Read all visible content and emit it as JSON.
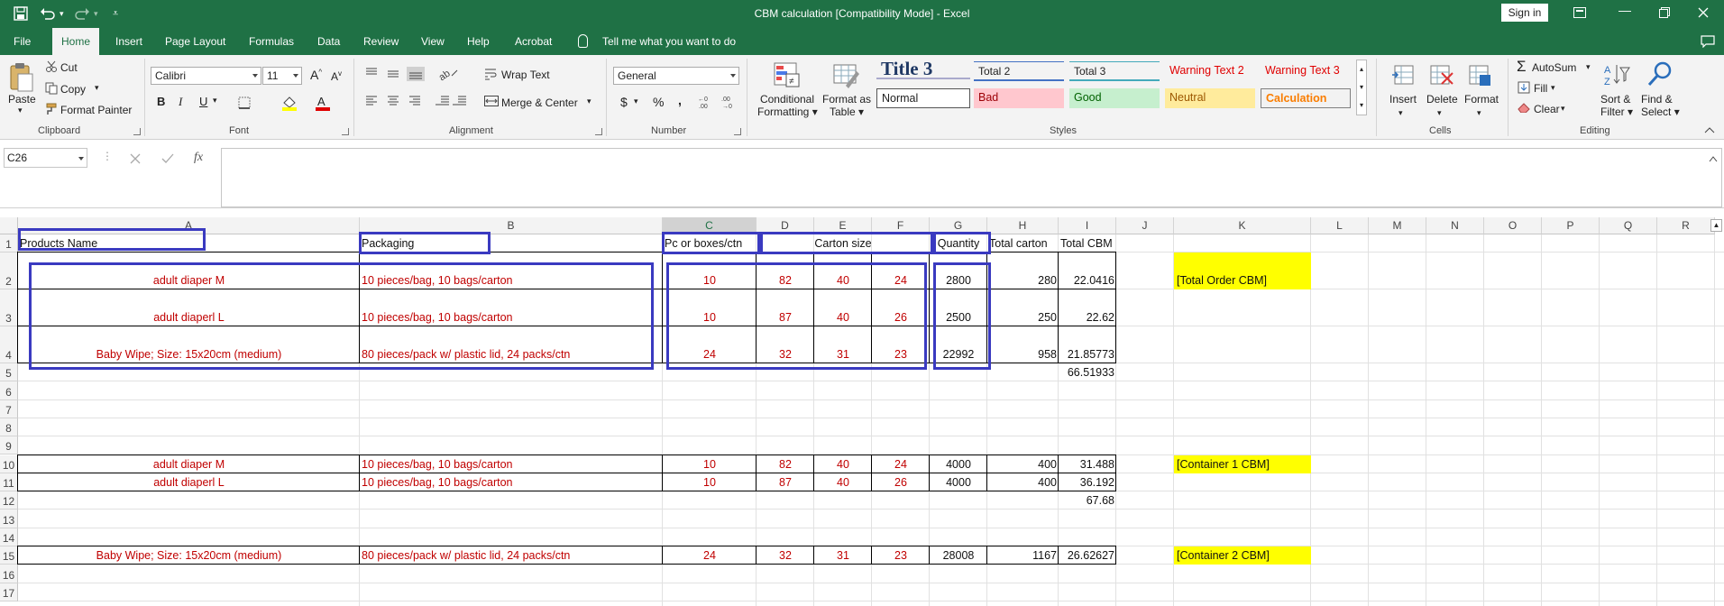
{
  "window": {
    "title": "CBM calculation  [Compatibility Mode]  -  Excel",
    "sign_in": "Sign in"
  },
  "tabs": [
    "File",
    "Home",
    "Insert",
    "Page Layout",
    "Formulas",
    "Data",
    "Review",
    "View",
    "Help",
    "Acrobat"
  ],
  "active_tab": "Home",
  "tell_me": "Tell me what you want to do",
  "ribbon": {
    "clipboard": {
      "label": "Clipboard",
      "paste": "Paste",
      "cut": "Cut",
      "copy": "Copy",
      "format_painter": "Format Painter"
    },
    "font": {
      "label": "Font",
      "name": "Calibri",
      "size": "11",
      "bold": "B",
      "italic": "I",
      "underline": "U"
    },
    "alignment": {
      "label": "Alignment",
      "wrap": "Wrap Text",
      "merge": "Merge & Center"
    },
    "number": {
      "label": "Number",
      "format": "General",
      "currency": "$",
      "percent": "%",
      "comma": ","
    },
    "styles": {
      "label": "Styles",
      "conditional": [
        "Conditional",
        "Formatting"
      ],
      "format_table": [
        "Format as",
        "Table"
      ],
      "title3": "Title 3",
      "total2": "Total 2",
      "total3": "Total 3",
      "warning2": "Warning Text 2",
      "warning3": "Warning Text 3",
      "normal": "Normal",
      "bad": "Bad",
      "good": "Good",
      "neutral": "Neutral",
      "calculation": "Calculation"
    },
    "cells": {
      "label": "Cells",
      "insert": "Insert",
      "delete": "Delete",
      "format": "Format"
    },
    "editing": {
      "label": "Editing",
      "autosum": "AutoSum",
      "fill": "Fill",
      "clear": "Clear",
      "sort": [
        "Sort &",
        "Filter"
      ],
      "find": [
        "Find &",
        "Select"
      ]
    }
  },
  "name_box": "C26",
  "columns": [
    "A",
    "B",
    "C",
    "D",
    "E",
    "F",
    "G",
    "H",
    "I",
    "J",
    "K",
    "L",
    "M",
    "N",
    "O",
    "P",
    "Q",
    "R"
  ],
  "selected_column": "C",
  "rows": [
    "1",
    "2",
    "3",
    "4",
    "5",
    "6",
    "7",
    "8",
    "9",
    "10",
    "11",
    "12",
    "13",
    "14",
    "15",
    "16",
    "17"
  ],
  "headers": {
    "product": "Products Name",
    "packaging": "Packaging",
    "pc": "Pc or boxes/ctn",
    "carton": "Carton size",
    "quantity": "Quantity",
    "total_carton": "Total carton",
    "total_cbm": "Total CBM"
  },
  "table1": [
    {
      "product": "adult diaper M",
      "packaging": "10 pieces/bag, 10 bags/carton",
      "pc": "10",
      "d": "82",
      "e": "40",
      "f": "24",
      "qty": "2800",
      "carton": "280",
      "cbm": "22.0416"
    },
    {
      "product": "adult diaperl L",
      "packaging": "10 pieces/bag, 10 bags/carton",
      "pc": "10",
      "d": "87",
      "e": "40",
      "f": "26",
      "qty": "2500",
      "carton": "250",
      "cbm": "22.62"
    },
    {
      "product": "Baby Wipe; Size: 15x20cm (medium)",
      "packaging": "80 pieces/pack w/ plastic lid, 24 packs/ctn",
      "pc": "24",
      "d": "32",
      "e": "31",
      "f": "23",
      "qty": "22992",
      "carton": "958",
      "cbm": "21.85773"
    }
  ],
  "total1": "66.51933",
  "table2": [
    {
      "product": "adult diaper M",
      "packaging": "10 pieces/bag, 10 bags/carton",
      "pc": "10",
      "d": "82",
      "e": "40",
      "f": "24",
      "qty": "4000",
      "carton": "400",
      "cbm": "31.488"
    },
    {
      "product": "adult diaperl L",
      "packaging": "10 pieces/bag, 10 bags/carton",
      "pc": "10",
      "d": "87",
      "e": "40",
      "f": "26",
      "qty": "4000",
      "carton": "400",
      "cbm": "36.192"
    }
  ],
  "total2": "67.68",
  "table3": [
    {
      "product": "Baby Wipe; Size: 15x20cm (medium)",
      "packaging": "80 pieces/pack w/ plastic lid, 24 packs/ctn",
      "pc": "24",
      "d": "32",
      "e": "31",
      "f": "23",
      "qty": "28008",
      "carton": "1167",
      "cbm": "26.62627"
    }
  ],
  "labels": {
    "order": "[Total Order CBM]",
    "container1": "[Container 1 CBM]",
    "container2": "[Container 2 CBM]"
  },
  "colors": {
    "excel_green": "#1f7145",
    "highlight_yellow": "#ffff00",
    "red_text": "#c00000",
    "annotation_blue": "#3a3ac0"
  }
}
